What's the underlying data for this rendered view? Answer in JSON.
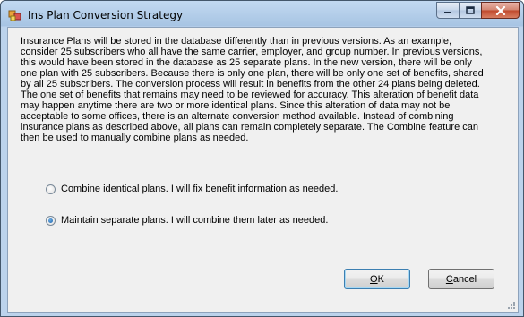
{
  "window": {
    "title": "Ins Plan Conversion Strategy"
  },
  "description_lines": [
    "Insurance Plans will be stored in the database differently than in previous versions.  As an example,",
    "consider 25 subscribers who all have the same carrier, employer, and group number.  In previous versions,",
    "this would have been stored in the database as 25 separate plans.  In the new version, there will be only",
    "one plan with 25 subscribers.  Because there is only one plan, there will be only one set of benefits, shared",
    "by all 25 subscribers.  The conversion process will result in benefits from the other 24 plans being deleted.",
    "The one set of benefits that remains may need to be reviewed for accuracy.  This alteration of benefit data",
    "may happen anytime there are two or more identical plans.  Since this alteration of data may not be",
    "acceptable to some offices, there is an alternate conversion method available.  Instead of combining",
    "insurance plans as described above, all plans can remain completely separate.  The Combine feature can",
    "then be used to manually combine plans as needed."
  ],
  "options": {
    "combine_label": "Combine identical plans. I will fix benefit information as needed.",
    "combine_selected": false,
    "separate_label": "Maintain separate plans.  I will combine them later as needed.",
    "separate_selected": true
  },
  "buttons": {
    "ok_mnemonic": "O",
    "ok_rest": "K",
    "cancel_mnemonic": "C",
    "cancel_rest": "ancel"
  },
  "icons": {
    "app": "app-icon",
    "minimize": "minimize-icon",
    "maximize": "maximize-icon",
    "close": "close-icon"
  },
  "colors": {
    "titlebar": "#a7c4e3",
    "client_bg": "#f0f0f0",
    "close_button": "#c0492c",
    "radio_dot": "#1a5fa8"
  }
}
